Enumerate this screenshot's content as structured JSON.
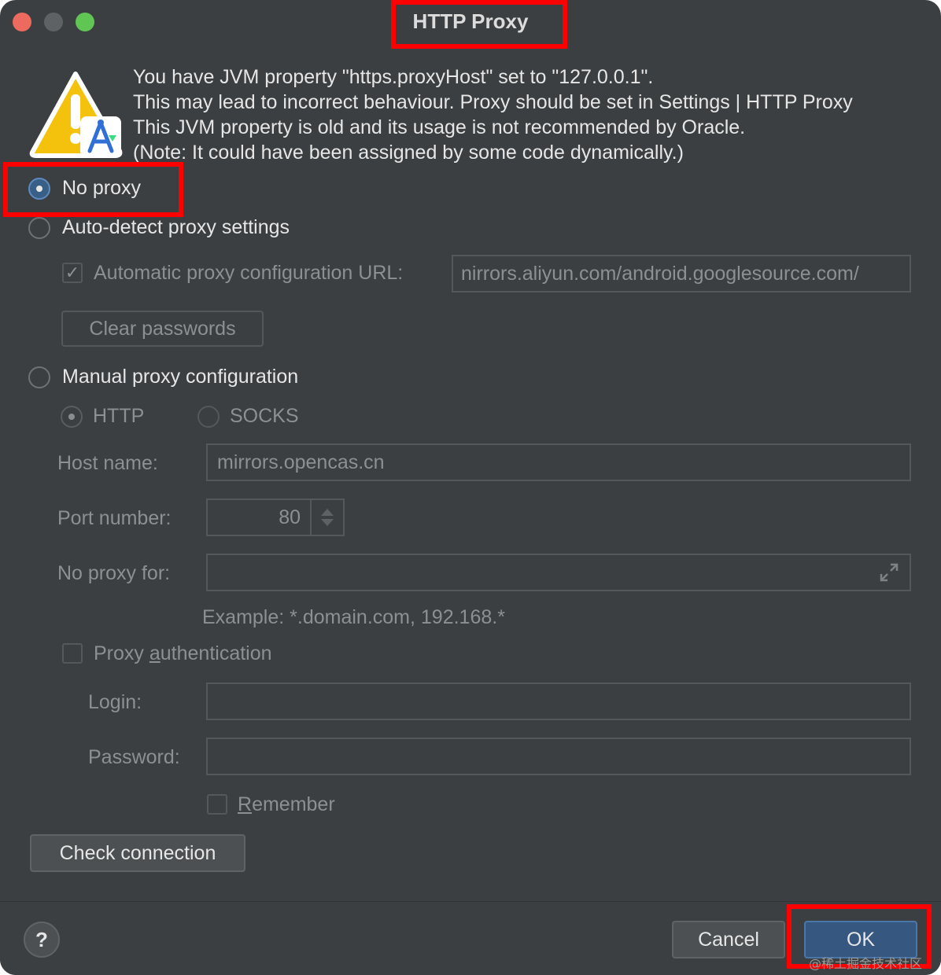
{
  "window": {
    "title": "HTTP Proxy"
  },
  "warning": {
    "lines": [
      "You have JVM property \"https.proxyHost\" set to \"127.0.0.1\".",
      "This may lead to incorrect behaviour. Proxy should be set in Settings | HTTP Proxy",
      "This JVM property is old and its usage is not recommended by Oracle.",
      "(Note: It could have been assigned by some code dynamically.)"
    ]
  },
  "options": {
    "no_proxy": "No proxy",
    "auto_detect": "Auto-detect proxy settings",
    "pac_label": "Automatic proxy configuration URL:",
    "pac_url": "nirrors.aliyun.com/android.googlesource.com/",
    "clear_passwords": "Clear passwords",
    "manual": "Manual proxy configuration",
    "http": "HTTP",
    "socks": "SOCKS"
  },
  "manual": {
    "host_label": "Host name:",
    "host_value": "mirrors.opencas.cn",
    "port_label": "Port number:",
    "port_value": "80",
    "no_proxy_label": "No proxy for:",
    "no_proxy_value": "",
    "example": "Example: *.domain.com, 192.168.*",
    "auth_label_pre": "Proxy ",
    "auth_label_u": "a",
    "auth_label_post": "uthentication",
    "login_label": "Login:",
    "password_label": "Password:",
    "remember_u": "R",
    "remember_post": "emember"
  },
  "buttons": {
    "check_connection": "Check connection",
    "help": "?",
    "cancel": "Cancel",
    "ok": "OK"
  },
  "watermark": "@稀土掘金技术社区",
  "colors": {
    "background": "#3c3f41",
    "accent": "#365880",
    "highlight": "#ff0000"
  }
}
